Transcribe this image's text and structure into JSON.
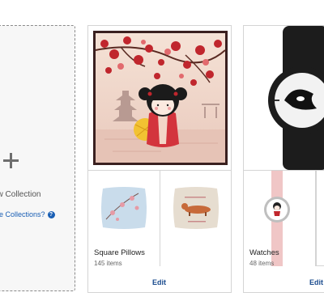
{
  "new_collection": {
    "label": "New Collection",
    "visible_label": "ew Collection",
    "share_link": "are Collections?",
    "help_icon": "?"
  },
  "collections": [
    {
      "title": "Square Pillows",
      "count": "145 items",
      "edit": "Edit"
    },
    {
      "title": "Watches",
      "count": "48 items",
      "edit": "Edit"
    }
  ],
  "colors": {
    "link": "#1a5fb4",
    "border": "#d4d4d4",
    "dashed": "#8a8a8a"
  }
}
